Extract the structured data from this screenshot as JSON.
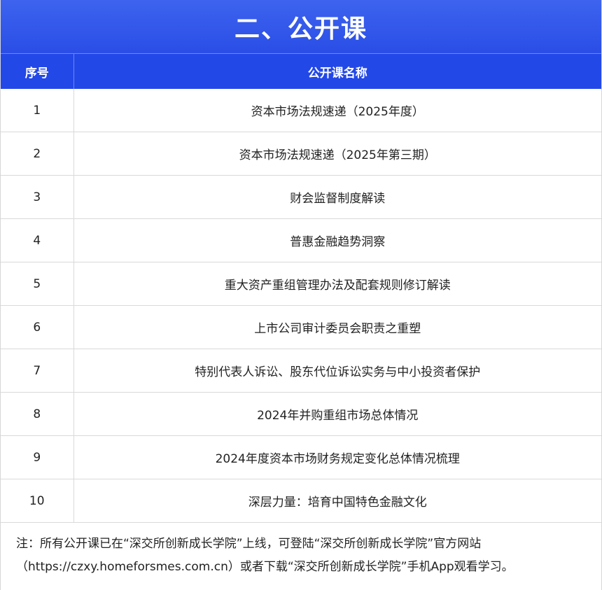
{
  "title": "二、公开课",
  "table": {
    "headers": [
      "序号",
      "公开课名称"
    ],
    "rows": [
      {
        "no": "1",
        "name": "资本市场法规速递（2025年度）"
      },
      {
        "no": "2",
        "name": "资本市场法规速递（2025年第三期）"
      },
      {
        "no": "3",
        "name": "财会监督制度解读"
      },
      {
        "no": "4",
        "name": "普惠金融趋势洞察"
      },
      {
        "no": "5",
        "name": "重大资产重组管理办法及配套规则修订解读"
      },
      {
        "no": "6",
        "name": "上市公司审计委员会职责之重塑"
      },
      {
        "no": "7",
        "name": "特别代表人诉讼、股东代位诉讼实务与中小投资者保护"
      },
      {
        "no": "8",
        "name": "2024年并购重组市场总体情况"
      },
      {
        "no": "9",
        "name": "2024年度资本市场财务规定变化总体情况梳理"
      },
      {
        "no": "10",
        "name": "深层力量：培育中国特色金融文化"
      }
    ]
  },
  "note": {
    "line1": "注：所有公开课已在“深交所创新成长学院”上线，可登陆“深交所创新成长学院”官方网站",
    "line2": "（https://czxy.homeforsmes.com.cn）或者下载“深交所创新成长学院”手机App观看学习。"
  }
}
